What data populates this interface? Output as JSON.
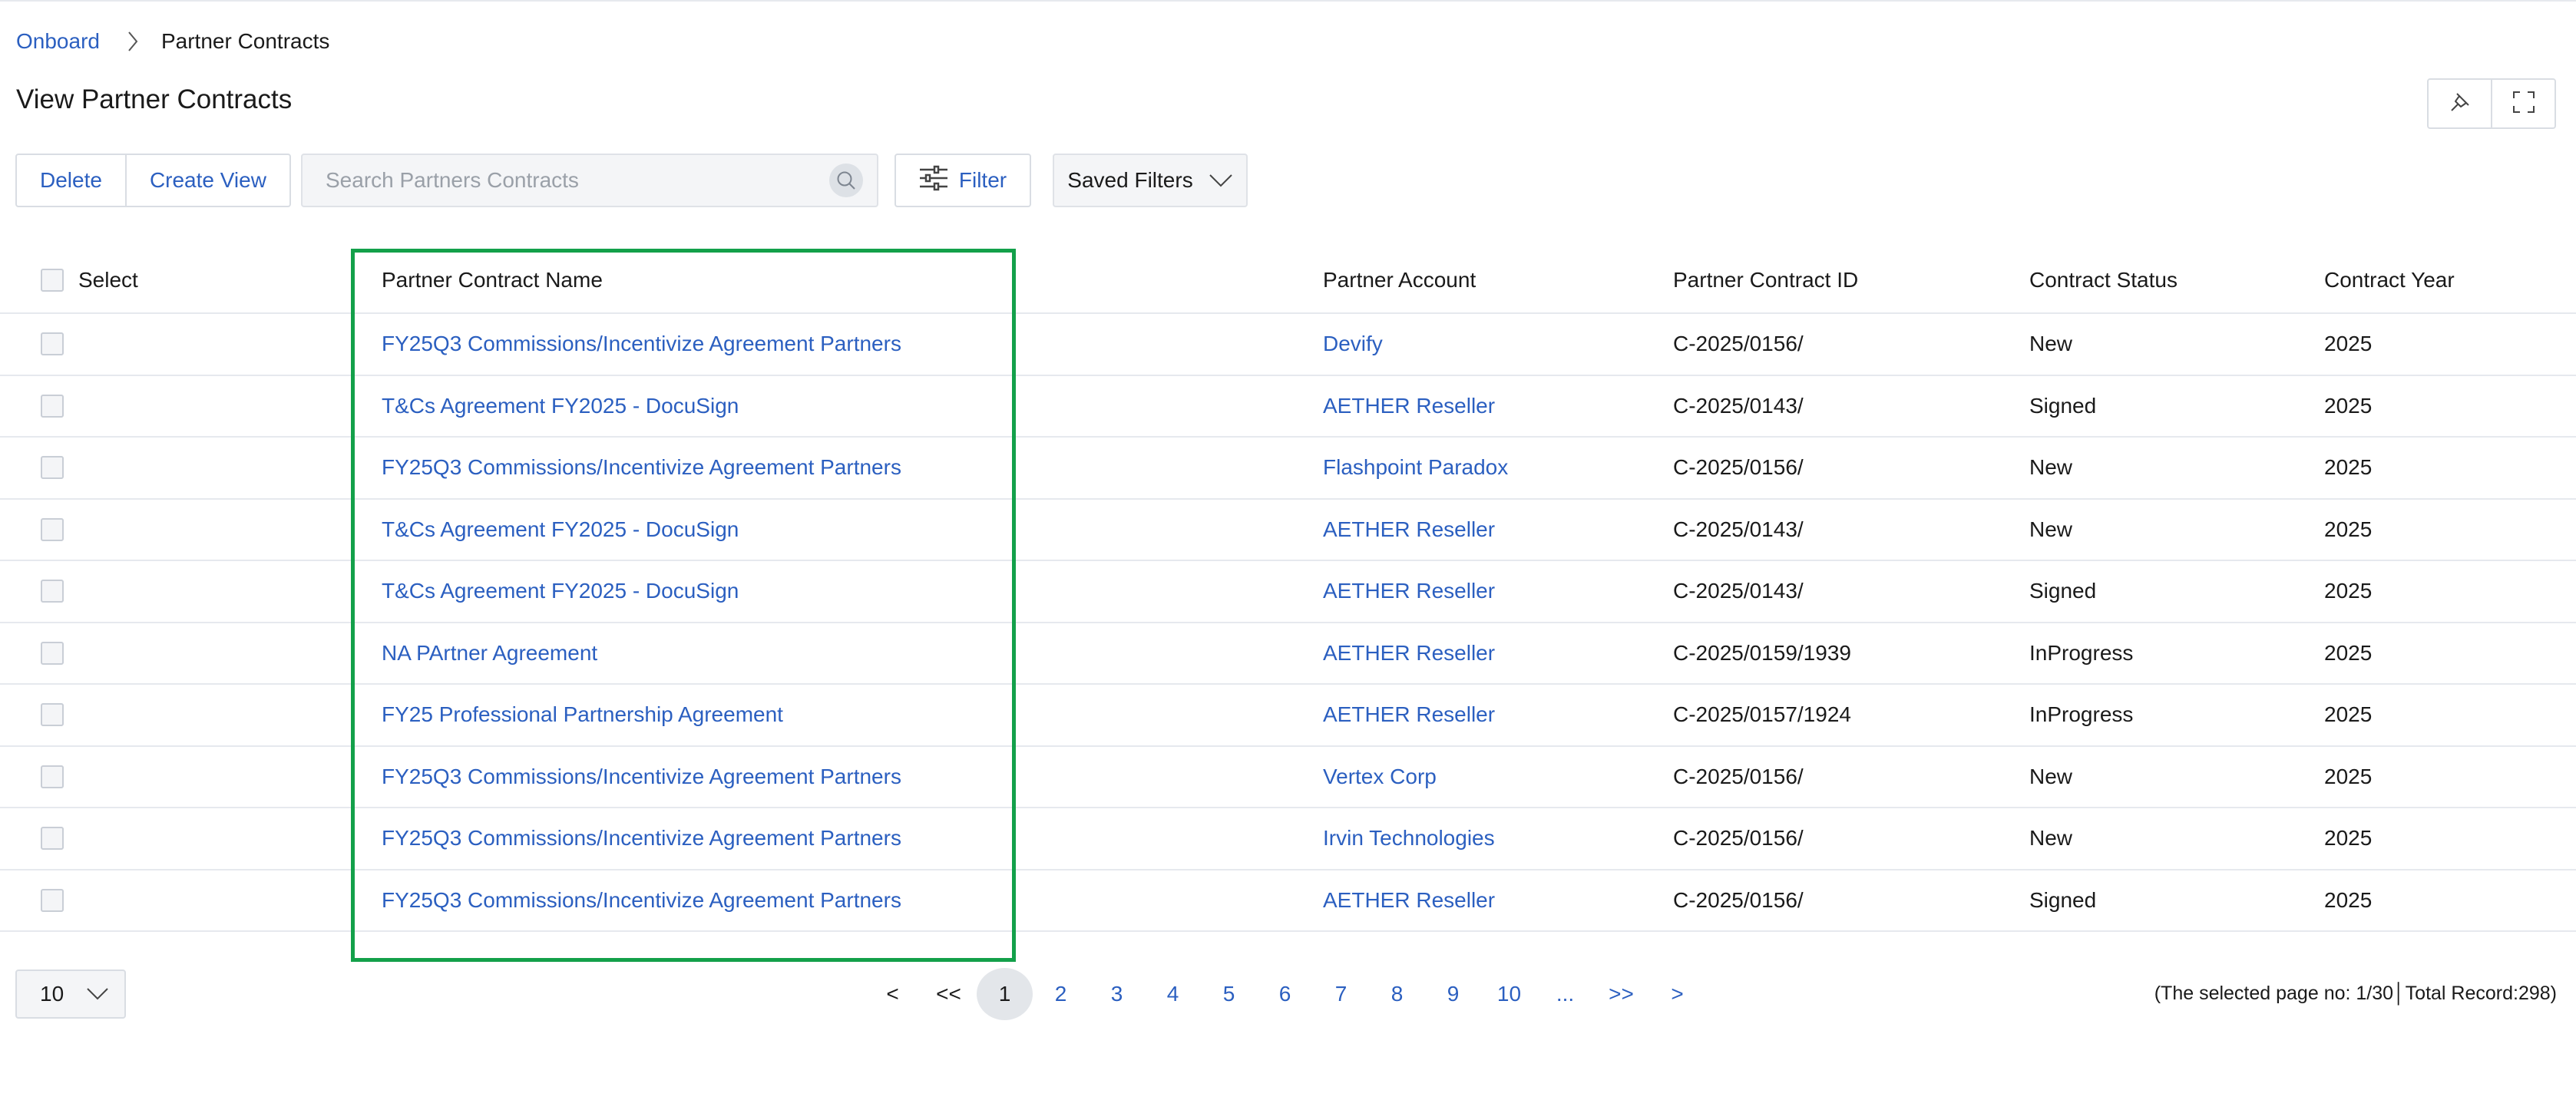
{
  "breadcrumb": {
    "root": "Onboard",
    "current": "Partner Contracts"
  },
  "page": {
    "title": "View Partner Contracts"
  },
  "toolbar": {
    "delete_label": "Delete",
    "create_view_label": "Create View",
    "search_placeholder": "Search Partners Contracts",
    "filter_label": "Filter",
    "saved_filters_label": "Saved Filters"
  },
  "icons": {
    "pin": "pin-icon",
    "fullscreen": "fullscreen-icon",
    "search": "search-icon",
    "filter": "sliders-icon",
    "chevron": "chevron-down-icon"
  },
  "table": {
    "select_header": "Select",
    "columns": [
      "Partner Contract Name",
      "Partner Account",
      "Partner Contract ID",
      "Contract Status",
      "Contract Year"
    ],
    "rows": [
      {
        "name": "FY25Q3 Commissions/Incentivize Agreement Partners",
        "account": "Devify",
        "id": "C-2025/0156/",
        "status": "New",
        "year": "2025"
      },
      {
        "name": "T&Cs Agreement FY2025 - DocuSign",
        "account": "AETHER Reseller",
        "id": "C-2025/0143/",
        "status": "Signed",
        "year": "2025"
      },
      {
        "name": "FY25Q3 Commissions/Incentivize Agreement Partners",
        "account": "Flashpoint Paradox",
        "id": "C-2025/0156/",
        "status": "New",
        "year": "2025"
      },
      {
        "name": "T&Cs Agreement FY2025 - DocuSign",
        "account": "AETHER Reseller",
        "id": "C-2025/0143/",
        "status": "New",
        "year": "2025"
      },
      {
        "name": "T&Cs Agreement FY2025 - DocuSign",
        "account": "AETHER Reseller",
        "id": "C-2025/0143/",
        "status": "Signed",
        "year": "2025"
      },
      {
        "name": "NA PArtner Agreement",
        "account": "AETHER Reseller",
        "id": "C-2025/0159/1939",
        "status": "InProgress",
        "year": "2025"
      },
      {
        "name": "FY25 Professional Partnership Agreement",
        "account": "AETHER Reseller",
        "id": "C-2025/0157/1924",
        "status": "InProgress",
        "year": "2025"
      },
      {
        "name": "FY25Q3 Commissions/Incentivize Agreement Partners",
        "account": "Vertex Corp",
        "id": "C-2025/0156/",
        "status": "New",
        "year": "2025"
      },
      {
        "name": "FY25Q3 Commissions/Incentivize Agreement Partners",
        "account": "Irvin Technologies",
        "id": "C-2025/0156/",
        "status": "New",
        "year": "2025"
      },
      {
        "name": "FY25Q3 Commissions/Incentivize Agreement Partners",
        "account": "AETHER Reseller",
        "id": "C-2025/0156/",
        "status": "Signed",
        "year": "2025"
      }
    ]
  },
  "pagination": {
    "page_size": "10",
    "prev": "<",
    "first": "<<",
    "pages": [
      "1",
      "2",
      "3",
      "4",
      "5",
      "6",
      "7",
      "8",
      "9",
      "10"
    ],
    "ellipsis": "...",
    "last": ">>",
    "next": ">",
    "current_page": "1",
    "status_text": "(The selected page no: 1/30│Total Record:298)"
  },
  "colors": {
    "link": "#2b5fc0",
    "highlight": "#13a04a",
    "border": "#d9dde3"
  }
}
